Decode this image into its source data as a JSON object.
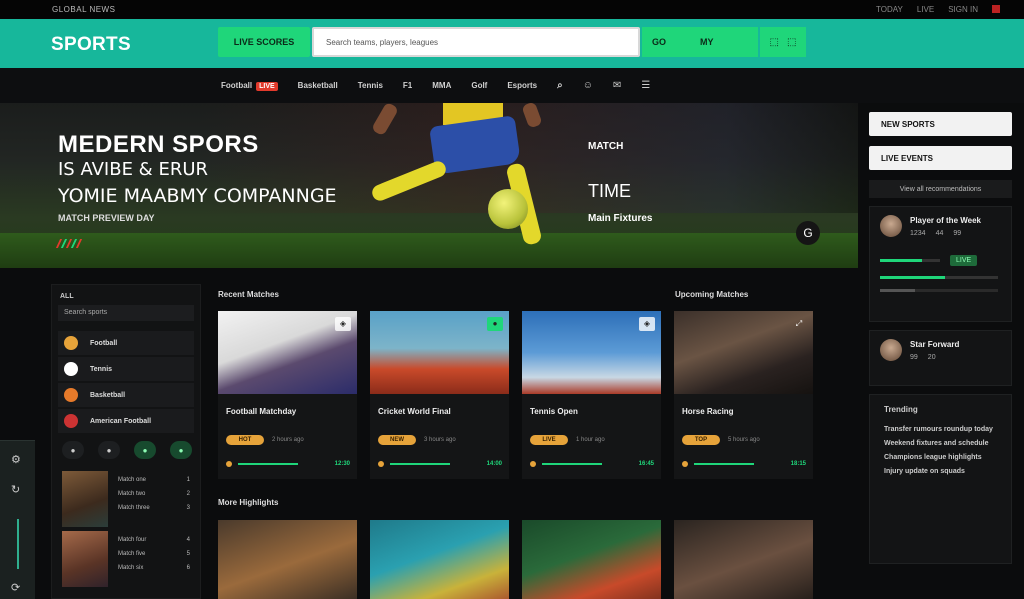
{
  "topbar": {
    "left_text": "GLOBAL NEWS",
    "right_links": [
      "TODAY",
      "LIVE",
      "SIGN IN",
      "EN"
    ]
  },
  "header": {
    "logo": "SPORTS",
    "left_button": "LIVE SCORES",
    "search_placeholder": "Search teams, players, leagues",
    "right_button_a": "GO",
    "right_button_b": "MY",
    "icon_box": [
      "⬚",
      "⬚"
    ]
  },
  "nav": {
    "items": [
      "Football",
      "Basketball",
      "Tennis",
      "F1",
      "MMA",
      "Golf",
      "Esports"
    ],
    "badge": "LIVE",
    "icons": [
      "search-icon",
      "user-icon",
      "chat-icon",
      "menu-icon"
    ]
  },
  "hero": {
    "title": "MEDERN SPORS",
    "sub1": "IS AVIBE & ERUR",
    "sub2": "YOMIE MAABMY COMPANNGE",
    "tag": "MATCH PREVIEW DAY",
    "right1": "MATCH",
    "right2": "TIME",
    "right3": "Main Fixtures",
    "round_btn": "G"
  },
  "right_panel": {
    "btn1": "NEW SPORTS",
    "btn2": "LIVE EVENTS",
    "link": "View all recommendations",
    "card1": {
      "name": "Player of the Week",
      "stat1": "1234",
      "stat2": "44",
      "stat3": "99",
      "chip": "LIVE"
    },
    "card2": {
      "name": "Star Forward",
      "stat1": "99",
      "stat2": "20"
    },
    "news_title": "Trending",
    "news": [
      "Transfer rumours roundup today",
      "Weekend fixtures and schedule",
      "Champions league highlights",
      "Injury update on squads"
    ]
  },
  "left_panel": {
    "heading": "ALL",
    "search": "Search sports",
    "items": [
      "Football",
      "Tennis",
      "Basketball",
      "American Football"
    ],
    "pills": [
      "●",
      "●",
      "●",
      "●"
    ],
    "rows": [
      "Match one",
      "Match two",
      "Match three",
      "Match four",
      "Match five",
      "Match six"
    ],
    "values": [
      "1",
      "2",
      "3",
      "4",
      "5",
      "6"
    ]
  },
  "sections": {
    "latest": "Recent Matches",
    "featured": "Upcoming Matches",
    "more": "More Highlights"
  },
  "cards": [
    {
      "title": "Football Matchday",
      "pill": "HOT",
      "meta": "2 hours ago",
      "num": "12:30"
    },
    {
      "title": "Cricket World Final",
      "pill": "NEW",
      "meta": "3 hours ago",
      "num": "14:00"
    },
    {
      "title": "Tennis Open",
      "pill": "LIVE",
      "meta": "1 hour ago",
      "num": "16:45"
    },
    {
      "title": "Horse Racing",
      "pill": "TOP",
      "meta": "5 hours ago",
      "num": "18:15"
    }
  ],
  "colors": {
    "accent": "#17b79b",
    "green": "#1fd67a",
    "orange": "#e6a33a",
    "bg": "#0b0c0d"
  }
}
